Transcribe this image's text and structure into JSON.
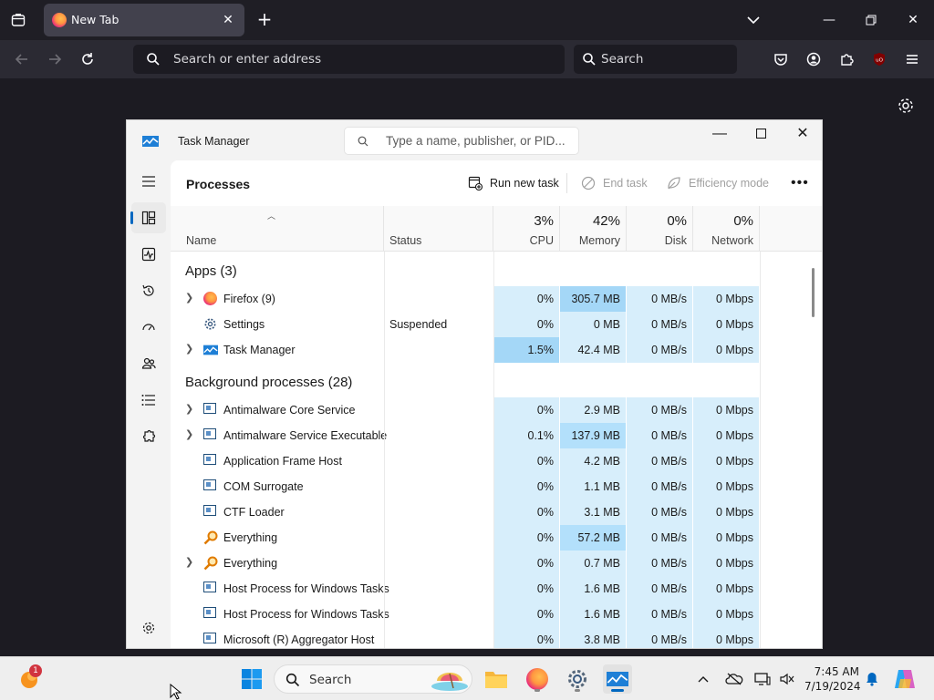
{
  "browser": {
    "tab_title": "New Tab",
    "url_placeholder": "Search or enter address",
    "search_placeholder": "Search"
  },
  "taskmanager": {
    "title": "Task Manager",
    "search_placeholder": "Type a name, publisher, or PID...",
    "pane_title": "Processes",
    "run_new_task": "Run new task",
    "end_task": "End task",
    "efficiency_mode": "Efficiency mode",
    "columns": {
      "name": "Name",
      "status": "Status",
      "cpu_pct": "3%",
      "cpu": "CPU",
      "memory_pct": "42%",
      "memory": "Memory",
      "disk_pct": "0%",
      "disk": "Disk",
      "network_pct": "0%",
      "network": "Network"
    },
    "groups": {
      "apps": "Apps (3)",
      "background": "Background processes (28)"
    },
    "apps": [
      {
        "name": "Firefox (9)",
        "status": "",
        "cpu": "0%",
        "memory": "305.7 MB",
        "disk": "0 MB/s",
        "network": "0 Mbps"
      },
      {
        "name": "Settings",
        "status": "Suspended",
        "cpu": "0%",
        "memory": "0 MB",
        "disk": "0 MB/s",
        "network": "0 Mbps"
      },
      {
        "name": "Task Manager",
        "status": "",
        "cpu": "1.5%",
        "memory": "42.4 MB",
        "disk": "0 MB/s",
        "network": "0 Mbps"
      }
    ],
    "background": [
      {
        "name": "Antimalware Core Service",
        "cpu": "0%",
        "memory": "2.9 MB",
        "disk": "0 MB/s",
        "network": "0 Mbps"
      },
      {
        "name": "Antimalware Service Executable",
        "cpu": "0.1%",
        "memory": "137.9 MB",
        "disk": "0 MB/s",
        "network": "0 Mbps"
      },
      {
        "name": "Application Frame Host",
        "cpu": "0%",
        "memory": "4.2 MB",
        "disk": "0 MB/s",
        "network": "0 Mbps"
      },
      {
        "name": "COM Surrogate",
        "cpu": "0%",
        "memory": "1.1 MB",
        "disk": "0 MB/s",
        "network": "0 Mbps"
      },
      {
        "name": "CTF Loader",
        "cpu": "0%",
        "memory": "3.1 MB",
        "disk": "0 MB/s",
        "network": "0 Mbps"
      },
      {
        "name": "Everything",
        "cpu": "0%",
        "memory": "57.2 MB",
        "disk": "0 MB/s",
        "network": "0 Mbps"
      },
      {
        "name": "Everything",
        "cpu": "0%",
        "memory": "0.7 MB",
        "disk": "0 MB/s",
        "network": "0 Mbps"
      },
      {
        "name": "Host Process for Windows Tasks",
        "cpu": "0%",
        "memory": "1.6 MB",
        "disk": "0 MB/s",
        "network": "0 Mbps"
      },
      {
        "name": "Host Process for Windows Tasks",
        "cpu": "0%",
        "memory": "1.6 MB",
        "disk": "0 MB/s",
        "network": "0 Mbps"
      },
      {
        "name": "Microsoft (R) Aggregator Host",
        "cpu": "0%",
        "memory": "3.8 MB",
        "disk": "0 MB/s",
        "network": "0 Mbps"
      }
    ]
  },
  "taskbar": {
    "search_placeholder": "Search",
    "time": "7:45 AM",
    "date": "7/19/2024",
    "notification_count": "1"
  },
  "colors": {
    "accent": "#0067c0",
    "cell_light": "#d7eefb",
    "cell_hot": "#b3e0fb"
  }
}
